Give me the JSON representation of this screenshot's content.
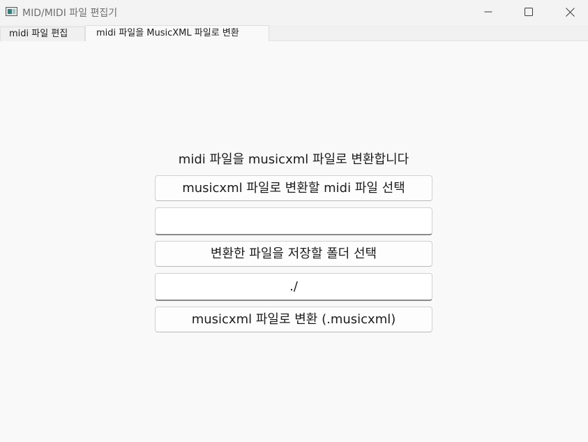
{
  "window": {
    "title": "MID/MIDI 파일 편집기"
  },
  "tabs": [
    {
      "label": "midi 파일 편집",
      "active": false
    },
    {
      "label": "midi 파일을 MusicXML 파일로 변환",
      "active": true
    }
  ],
  "main": {
    "heading": "midi 파일을 musicxml 파일로 변환합니다",
    "select_midi_button": "musicxml 파일로 변환할 midi 파일 선택",
    "midi_path_value": "",
    "select_folder_button": "변환한 파일을 저장할 폴더 선택",
    "output_folder_value": "./",
    "convert_button": "musicxml 파일로 변환 (.musicxml)"
  },
  "icons": {
    "app": "app-window-icon",
    "minimize": "minimize-icon",
    "maximize": "maximize-icon",
    "close": "close-icon"
  }
}
